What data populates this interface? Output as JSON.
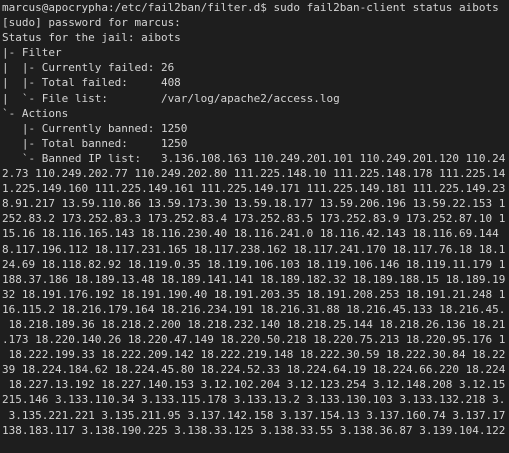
{
  "prompt": {
    "user_host_path": "marcus@apocrypha:/etc/fail2ban/filter.d$",
    "command": " sudo fail2ban-client status aibots"
  },
  "output": [
    "[sudo] password for marcus:",
    "Status for the jail: aibots",
    "|- Filter",
    "|  |- Currently failed: 26",
    "|  |- Total failed:     408",
    "|  `- File list:        /var/log/apache2/access.log",
    "`- Actions",
    "   |- Currently banned: 1250",
    "   |- Total banned:     1250",
    "   `- Banned IP list:   3.136.108.163 110.249.201.101 110.249.201.120 110.24",
    "2.73 110.249.202.77 110.249.202.80 111.225.148.10 111.225.148.178 111.225.14",
    "1.225.149.160 111.225.149.161 111.225.149.171 111.225.149.181 111.225.149.23",
    "8.91.217 13.59.110.86 13.59.173.30 13.59.18.177 13.59.206.196 13.59.22.153 1",
    "252.83.2 173.252.83.3 173.252.83.4 173.252.83.5 173.252.83.9 173.252.87.10 1",
    "15.16 18.116.165.143 18.116.230.40 18.116.241.0 18.116.42.143 18.116.69.144",
    "8.117.196.112 18.117.231.165 18.117.238.162 18.117.241.170 18.117.76.18 18.1",
    "24.69 18.118.82.92 18.119.0.35 18.119.106.103 18.119.106.146 18.119.11.179 1",
    "188.37.186 18.189.13.48 18.189.141.141 18.189.182.32 18.189.188.15 18.189.19",
    "32 18.191.176.192 18.191.190.40 18.191.203.35 18.191.208.253 18.191.21.248 1",
    "16.115.2 18.216.179.164 18.216.234.191 18.216.31.88 18.216.45.133 18.216.45.",
    " 18.218.189.36 18.218.2.200 18.218.232.140 18.218.25.144 18.218.26.136 18.21",
    ".173 18.220.140.26 18.220.47.149 18.220.50.218 18.220.75.213 18.220.95.176 1",
    " 18.222.199.33 18.222.209.142 18.222.219.148 18.222.30.59 18.222.30.84 18.22",
    "39 18.224.184.62 18.224.45.80 18.224.52.33 18.224.64.19 18.224.66.220 18.224",
    " 18.227.13.192 18.227.140.153 3.12.102.204 3.12.123.254 3.12.148.208 3.12.15",
    "215.146 3.133.110.34 3.133.115.178 3.133.13.2 3.133.130.103 3.133.132.218 3.",
    " 3.135.221.221 3.135.211.95 3.137.142.158 3.137.154.13 3.137.160.74 3.137.17",
    "138.183.117 3.138.190.225 3.138.33.125 3.138.33.55 3.138.36.87 3.139.104.122"
  ]
}
